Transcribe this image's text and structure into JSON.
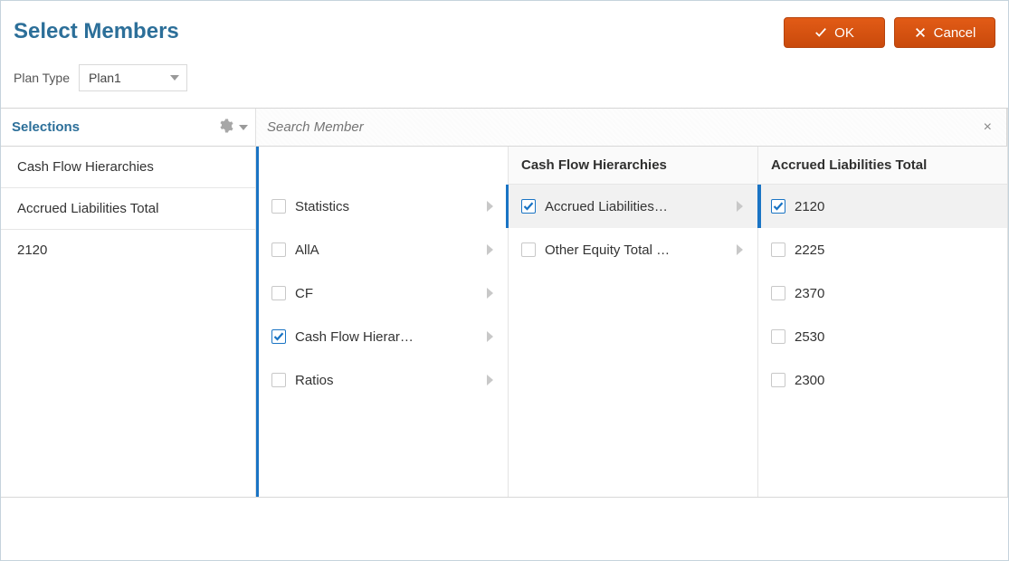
{
  "title": "Select Members",
  "buttons": {
    "ok": "OK",
    "cancel": "Cancel"
  },
  "planType": {
    "label": "Plan Type",
    "value": "Plan1"
  },
  "sidebar": {
    "title": "Selections",
    "items": [
      {
        "label": "Cash Flow Hierarchies"
      },
      {
        "label": "Accrued Liabilities Total"
      },
      {
        "label": "2120"
      }
    ]
  },
  "search": {
    "placeholder": "Search Member"
  },
  "columns": [
    {
      "header": "",
      "items": [
        {
          "label": "Statistics",
          "checked": false,
          "expandable": true,
          "selected": false
        },
        {
          "label": "AllA",
          "checked": false,
          "expandable": true,
          "selected": false
        },
        {
          "label": "CF",
          "checked": false,
          "expandable": true,
          "selected": false
        },
        {
          "label": "Cash Flow Hierar…",
          "checked": true,
          "expandable": true,
          "selected": false
        },
        {
          "label": "Ratios",
          "checked": false,
          "expandable": true,
          "selected": false
        }
      ]
    },
    {
      "header": "Cash Flow Hierarchies",
      "items": [
        {
          "label": "Accrued Liabilities…",
          "checked": true,
          "expandable": true,
          "selected": true
        },
        {
          "label": "Other Equity Total …",
          "checked": false,
          "expandable": true,
          "selected": false
        }
      ]
    },
    {
      "header": "Accrued Liabilities Total",
      "items": [
        {
          "label": "2120",
          "checked": true,
          "expandable": false,
          "selected": true
        },
        {
          "label": "2225",
          "checked": false,
          "expandable": false,
          "selected": false
        },
        {
          "label": "2370",
          "checked": false,
          "expandable": false,
          "selected": false
        },
        {
          "label": "2530",
          "checked": false,
          "expandable": false,
          "selected": false
        },
        {
          "label": "2300",
          "checked": false,
          "expandable": false,
          "selected": false
        }
      ]
    }
  ]
}
